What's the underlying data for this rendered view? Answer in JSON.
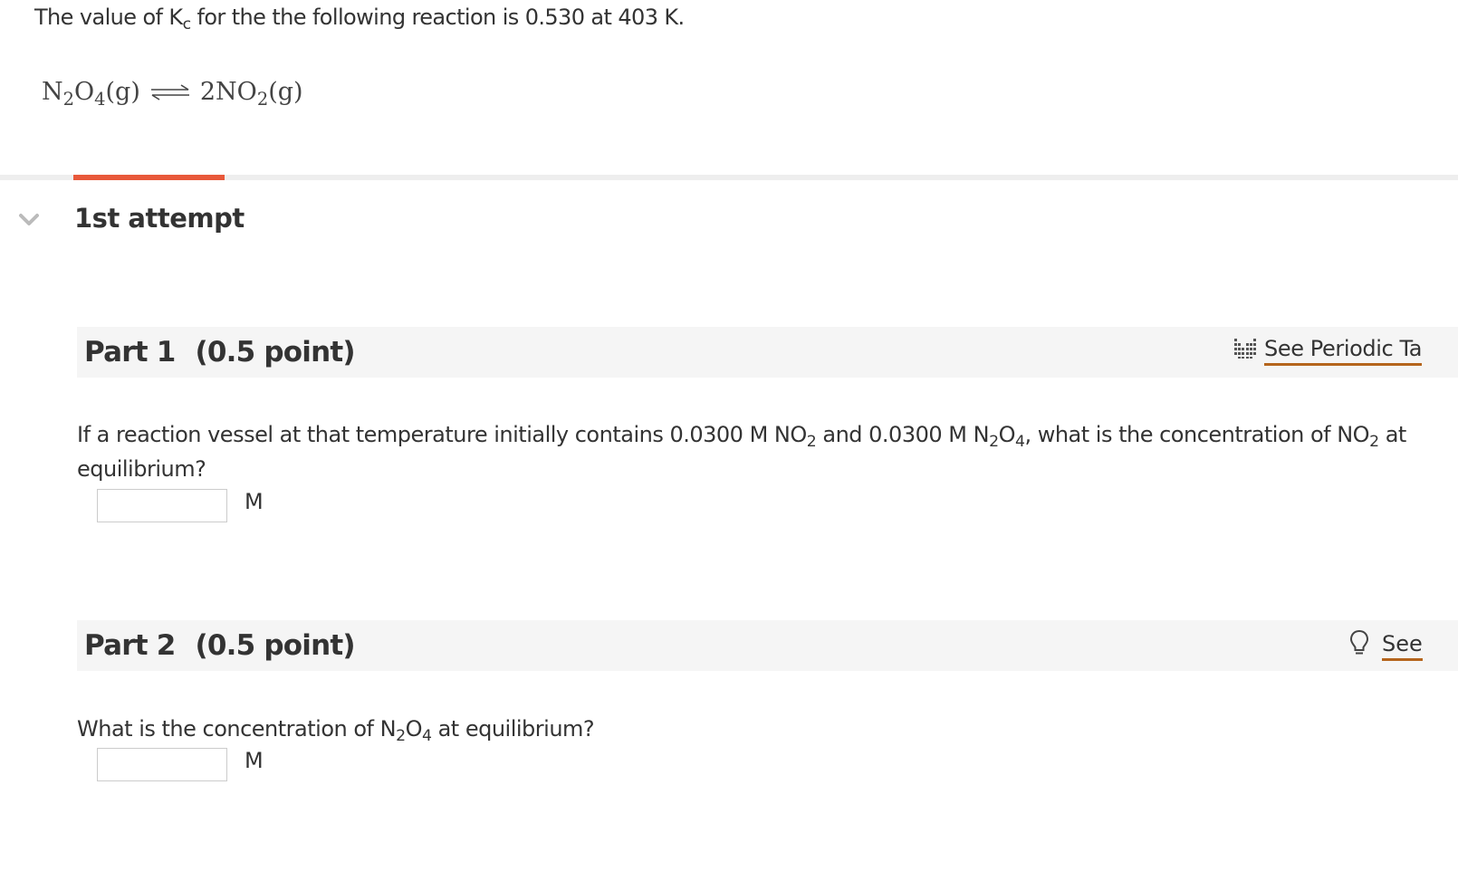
{
  "problem": {
    "intro": {
      "before": "The value of K",
      "sub": "c",
      "after": " for the the following reaction is 0.530 at  403 K."
    },
    "reaction": {
      "reactant": {
        "a": "N",
        "s1": "2",
        "b": "O",
        "s2": "4",
        "phase": "(g)"
      },
      "product": {
        "a": "2NO",
        "s1": "2",
        "phase": "(g)"
      }
    }
  },
  "attempt": {
    "label": "1st attempt"
  },
  "parts": [
    {
      "title": "Part 1",
      "points": "(0.5 point)",
      "link_label": "See Periodic Ta",
      "link_icon": "periodic-table-icon",
      "question": {
        "t1": "If a reaction vessel at that temperature initially contains 0.0300  M NO",
        "s1": "2",
        "t2": " and 0.0300  M N",
        "s2": "2",
        "t3": "O",
        "s3": "4",
        "t4": ", what is the concentration of NO",
        "s4": "2",
        "t5": " at equilibrium?"
      },
      "answer_value": "",
      "unit": "M"
    },
    {
      "title": "Part 2",
      "points": "(0.5 point)",
      "link_label": "See",
      "link_icon": "lightbulb-icon",
      "question": {
        "t1": "What is the concentration of N",
        "s1": "2",
        "t2": "O",
        "s2": "4",
        "t3": " at equilibrium?"
      },
      "answer_value": "",
      "unit": "M"
    }
  ],
  "colors": {
    "accent_tab": "#e8583a",
    "link_underline": "#b5651d",
    "header_bg": "#f5f5f5"
  }
}
